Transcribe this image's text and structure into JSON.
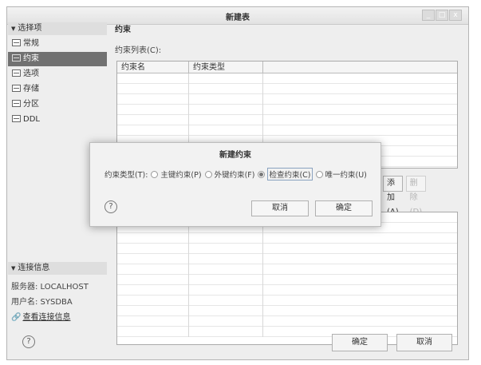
{
  "window": {
    "title": "新建表",
    "controls": [
      "_",
      "□",
      "x"
    ]
  },
  "sidebar": {
    "options_header": "选择项",
    "items": [
      {
        "label": "常规",
        "selected": false
      },
      {
        "label": "约束",
        "selected": true
      },
      {
        "label": "选项",
        "selected": false
      },
      {
        "label": "存储",
        "selected": false
      },
      {
        "label": "分区",
        "selected": false
      },
      {
        "label": "DDL",
        "selected": false
      }
    ],
    "conn_header": "连接信息",
    "server_line": "服务器: LOCALHOST",
    "user_line": "用户名: SYSDBA",
    "view_conn_link": "查看连接信息"
  },
  "main": {
    "title": "约束",
    "list_label": "约束列表(C):",
    "columns": [
      "约束名",
      "约束类型"
    ],
    "add_button": "添加(A)",
    "delete_button": "删除(D)"
  },
  "footer": {
    "help": "?",
    "ok": "确定",
    "cancel": "取消"
  },
  "dialog": {
    "title": "新建约束",
    "type_label": "约束类型(T):",
    "options": [
      {
        "label": "主键约束(P)",
        "checked": false
      },
      {
        "label": "外键约束(F)",
        "checked": false
      },
      {
        "label": "检查约束(C)",
        "checked": true
      },
      {
        "label": "唯一约束(U)",
        "checked": false
      }
    ],
    "help": "?",
    "cancel": "取消",
    "ok": "确定"
  }
}
